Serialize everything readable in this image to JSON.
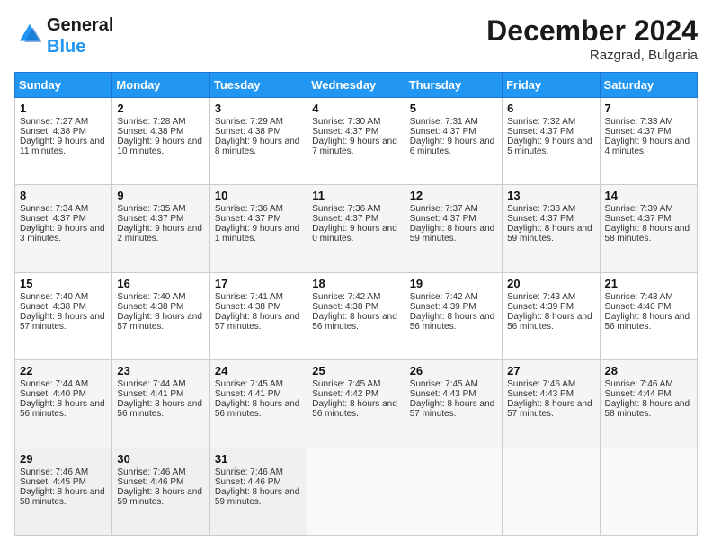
{
  "logo": {
    "line1": "General",
    "line2": "Blue"
  },
  "title": "December 2024",
  "location": "Razgrad, Bulgaria",
  "days_header": [
    "Sunday",
    "Monday",
    "Tuesday",
    "Wednesday",
    "Thursday",
    "Friday",
    "Saturday"
  ],
  "weeks": [
    [
      {
        "day": "1",
        "sunrise": "7:27 AM",
        "sunset": "4:38 PM",
        "daylight": "9 hours and 11 minutes."
      },
      {
        "day": "2",
        "sunrise": "7:28 AM",
        "sunset": "4:38 PM",
        "daylight": "9 hours and 10 minutes."
      },
      {
        "day": "3",
        "sunrise": "7:29 AM",
        "sunset": "4:38 PM",
        "daylight": "9 hours and 8 minutes."
      },
      {
        "day": "4",
        "sunrise": "7:30 AM",
        "sunset": "4:37 PM",
        "daylight": "9 hours and 7 minutes."
      },
      {
        "day": "5",
        "sunrise": "7:31 AM",
        "sunset": "4:37 PM",
        "daylight": "9 hours and 6 minutes."
      },
      {
        "day": "6",
        "sunrise": "7:32 AM",
        "sunset": "4:37 PM",
        "daylight": "9 hours and 5 minutes."
      },
      {
        "day": "7",
        "sunrise": "7:33 AM",
        "sunset": "4:37 PM",
        "daylight": "9 hours and 4 minutes."
      }
    ],
    [
      {
        "day": "8",
        "sunrise": "7:34 AM",
        "sunset": "4:37 PM",
        "daylight": "9 hours and 3 minutes."
      },
      {
        "day": "9",
        "sunrise": "7:35 AM",
        "sunset": "4:37 PM",
        "daylight": "9 hours and 2 minutes."
      },
      {
        "day": "10",
        "sunrise": "7:36 AM",
        "sunset": "4:37 PM",
        "daylight": "9 hours and 1 minutes."
      },
      {
        "day": "11",
        "sunrise": "7:36 AM",
        "sunset": "4:37 PM",
        "daylight": "9 hours and 0 minutes."
      },
      {
        "day": "12",
        "sunrise": "7:37 AM",
        "sunset": "4:37 PM",
        "daylight": "8 hours and 59 minutes."
      },
      {
        "day": "13",
        "sunrise": "7:38 AM",
        "sunset": "4:37 PM",
        "daylight": "8 hours and 59 minutes."
      },
      {
        "day": "14",
        "sunrise": "7:39 AM",
        "sunset": "4:37 PM",
        "daylight": "8 hours and 58 minutes."
      }
    ],
    [
      {
        "day": "15",
        "sunrise": "7:40 AM",
        "sunset": "4:38 PM",
        "daylight": "8 hours and 57 minutes."
      },
      {
        "day": "16",
        "sunrise": "7:40 AM",
        "sunset": "4:38 PM",
        "daylight": "8 hours and 57 minutes."
      },
      {
        "day": "17",
        "sunrise": "7:41 AM",
        "sunset": "4:38 PM",
        "daylight": "8 hours and 57 minutes."
      },
      {
        "day": "18",
        "sunrise": "7:42 AM",
        "sunset": "4:38 PM",
        "daylight": "8 hours and 56 minutes."
      },
      {
        "day": "19",
        "sunrise": "7:42 AM",
        "sunset": "4:39 PM",
        "daylight": "8 hours and 56 minutes."
      },
      {
        "day": "20",
        "sunrise": "7:43 AM",
        "sunset": "4:39 PM",
        "daylight": "8 hours and 56 minutes."
      },
      {
        "day": "21",
        "sunrise": "7:43 AM",
        "sunset": "4:40 PM",
        "daylight": "8 hours and 56 minutes."
      }
    ],
    [
      {
        "day": "22",
        "sunrise": "7:44 AM",
        "sunset": "4:40 PM",
        "daylight": "8 hours and 56 minutes."
      },
      {
        "day": "23",
        "sunrise": "7:44 AM",
        "sunset": "4:41 PM",
        "daylight": "8 hours and 56 minutes."
      },
      {
        "day": "24",
        "sunrise": "7:45 AM",
        "sunset": "4:41 PM",
        "daylight": "8 hours and 56 minutes."
      },
      {
        "day": "25",
        "sunrise": "7:45 AM",
        "sunset": "4:42 PM",
        "daylight": "8 hours and 56 minutes."
      },
      {
        "day": "26",
        "sunrise": "7:45 AM",
        "sunset": "4:43 PM",
        "daylight": "8 hours and 57 minutes."
      },
      {
        "day": "27",
        "sunrise": "7:46 AM",
        "sunset": "4:43 PM",
        "daylight": "8 hours and 57 minutes."
      },
      {
        "day": "28",
        "sunrise": "7:46 AM",
        "sunset": "4:44 PM",
        "daylight": "8 hours and 58 minutes."
      }
    ],
    [
      {
        "day": "29",
        "sunrise": "7:46 AM",
        "sunset": "4:45 PM",
        "daylight": "8 hours and 58 minutes."
      },
      {
        "day": "30",
        "sunrise": "7:46 AM",
        "sunset": "4:46 PM",
        "daylight": "8 hours and 59 minutes."
      },
      {
        "day": "31",
        "sunrise": "7:46 AM",
        "sunset": "4:46 PM",
        "daylight": "8 hours and 59 minutes."
      },
      null,
      null,
      null,
      null
    ]
  ],
  "labels": {
    "sunrise": "Sunrise: ",
    "sunset": "Sunset: ",
    "daylight": "Daylight: "
  }
}
